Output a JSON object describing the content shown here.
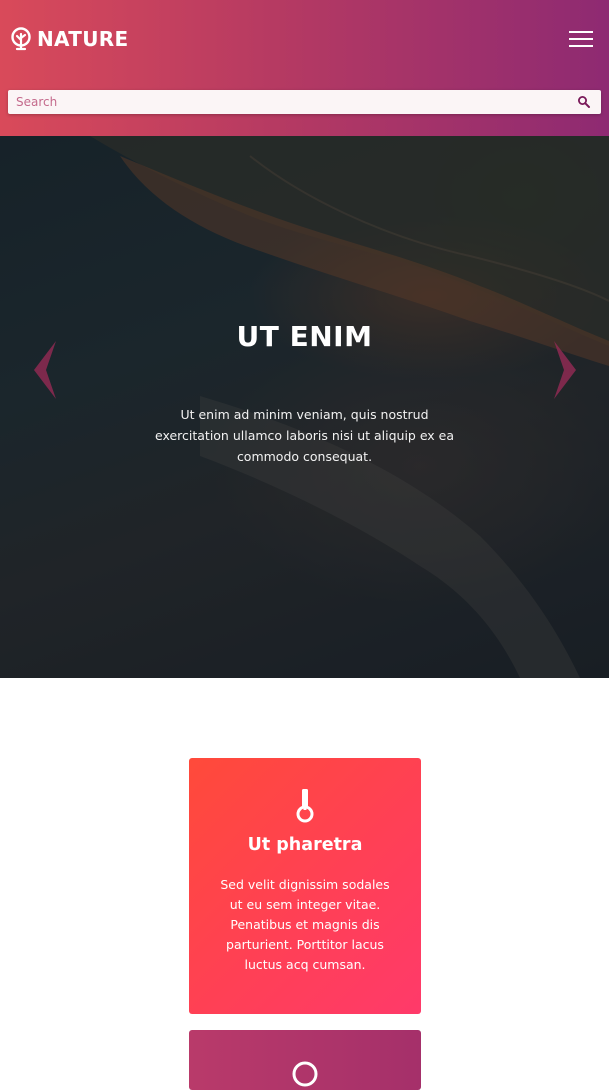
{
  "header": {
    "logo_text": "NATURE",
    "logo_icon": "tree-icon",
    "menu_icon": "hamburger-menu-icon"
  },
  "search": {
    "placeholder": "Search",
    "icon": "search-icon"
  },
  "hero": {
    "title": "UT ENIM",
    "text": "Ut enim ad minim veniam, quis nostrud exercitation ullamco laboris nisi ut aliquip ex ea commodo consequat.",
    "prev_icon": "chevron-left-icon",
    "next_icon": "chevron-right-icon"
  },
  "cards": [
    {
      "icon": "thermometer-icon",
      "title": "Ut pharetra",
      "text": "Sed velit dignissim sodales ut eu sem integer vitae. Penatibus et magnis dis parturient. Porttitor lacus luctus acq cumsan."
    },
    {
      "icon": "circle-icon"
    }
  ],
  "colors": {
    "header_start": "#d94a5a",
    "header_end": "#8e2a72",
    "card_primary": "#ff4050",
    "card_secondary": "#a5306a",
    "arrow": "#8e2a52"
  }
}
